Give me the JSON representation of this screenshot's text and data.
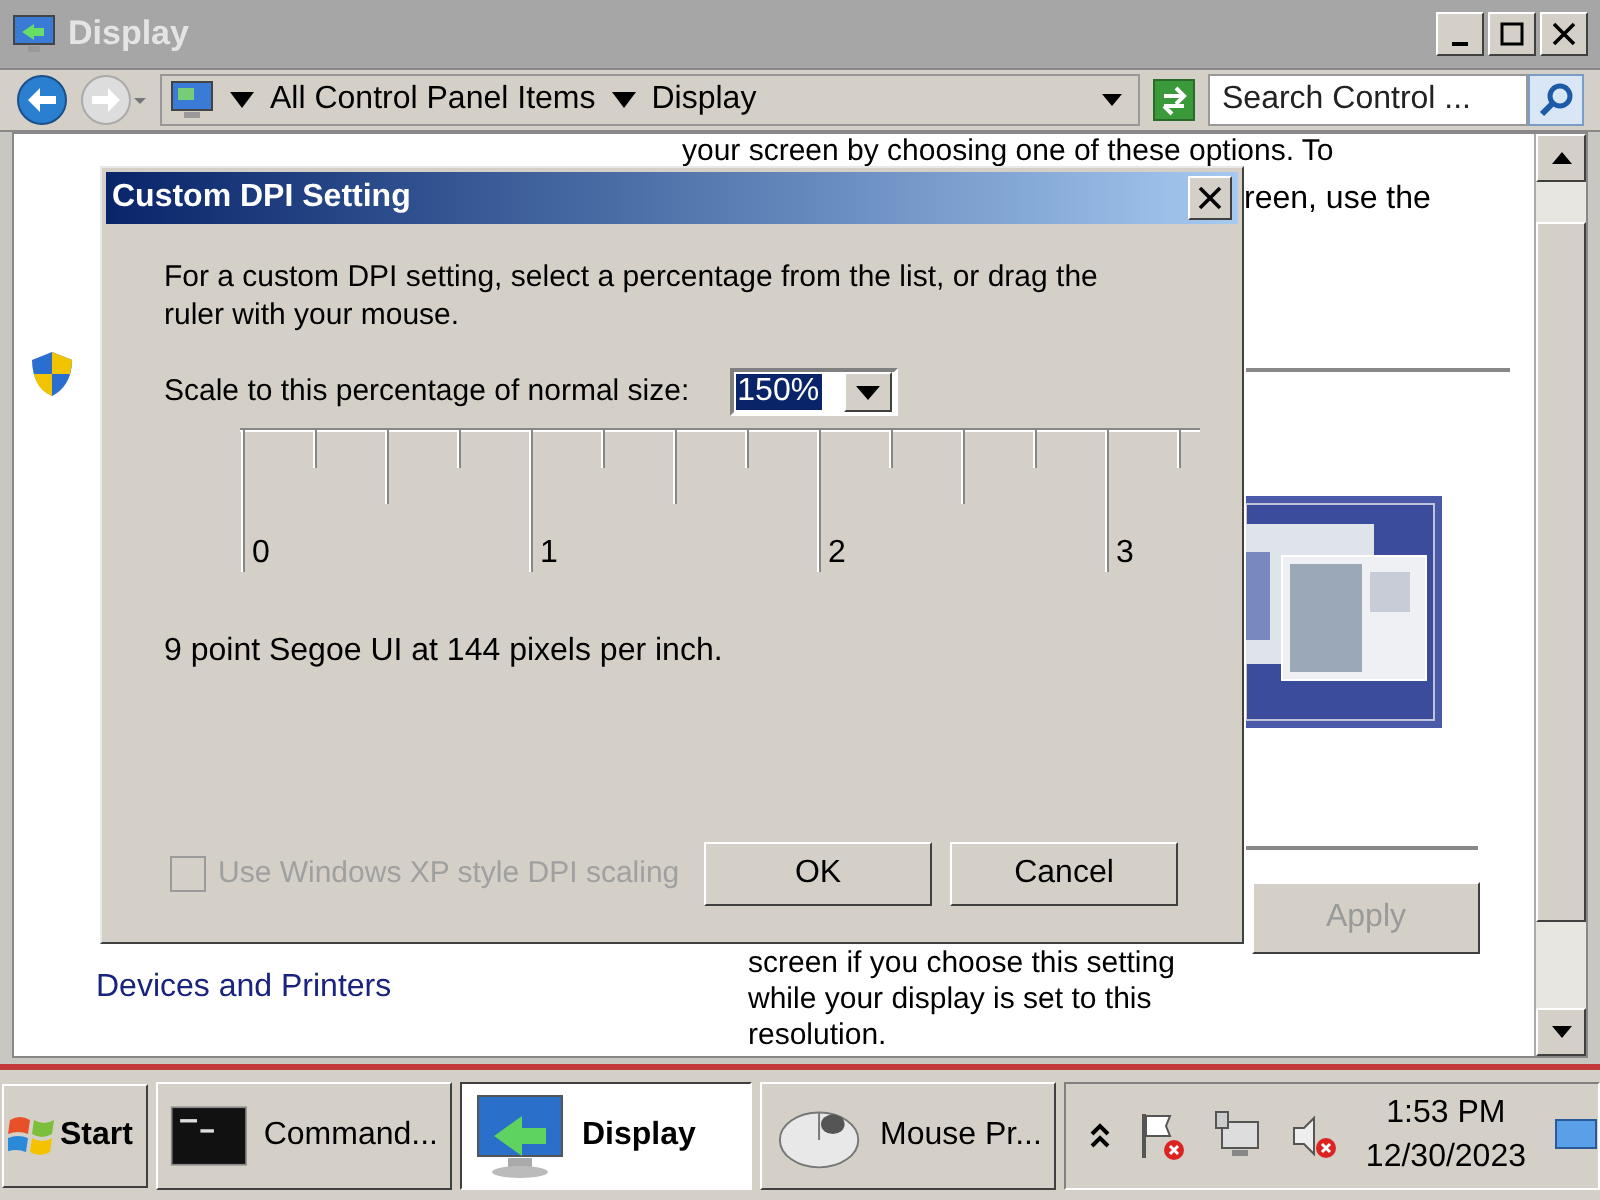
{
  "window": {
    "title": "Display"
  },
  "address": {
    "crumbs": [
      "All Control Panel Items",
      "Display"
    ],
    "search": {
      "placeholder": "Search Control ..."
    }
  },
  "content": {
    "top_lines": [
      "your screen by choosing one of these options. To",
      "reen, use the"
    ],
    "link": "Devices and Printers",
    "apply": {
      "label": "Apply",
      "disabled": true
    },
    "bottom_lines": [
      "screen if you choose this setting",
      "while your display is set to this",
      "resolution."
    ]
  },
  "dialog": {
    "title": "Custom DPI Setting",
    "instructions": "For a custom DPI setting, select a percentage from the list, or drag the ruler with your mouse.",
    "scale_label": "Scale to this percentage of normal size:",
    "scale_value": "150%",
    "ruler_labels": [
      "0",
      "1",
      "2",
      "3"
    ],
    "info": "9 point Segoe UI at 144 pixels per inch.",
    "checkbox": {
      "label": "Use Windows XP style DPI scaling",
      "checked": false,
      "disabled": true
    },
    "buttons": [
      "OK",
      "Cancel"
    ]
  },
  "taskbar": {
    "start": "Start",
    "tasks": [
      {
        "label": "Command...",
        "kind": "terminal",
        "selected": false
      },
      {
        "label": "Display",
        "kind": "monitor",
        "selected": true
      },
      {
        "label": "Mouse Pr...",
        "kind": "mouse",
        "selected": false
      }
    ],
    "time": "1:53 PM",
    "date": "12/30/2023"
  }
}
